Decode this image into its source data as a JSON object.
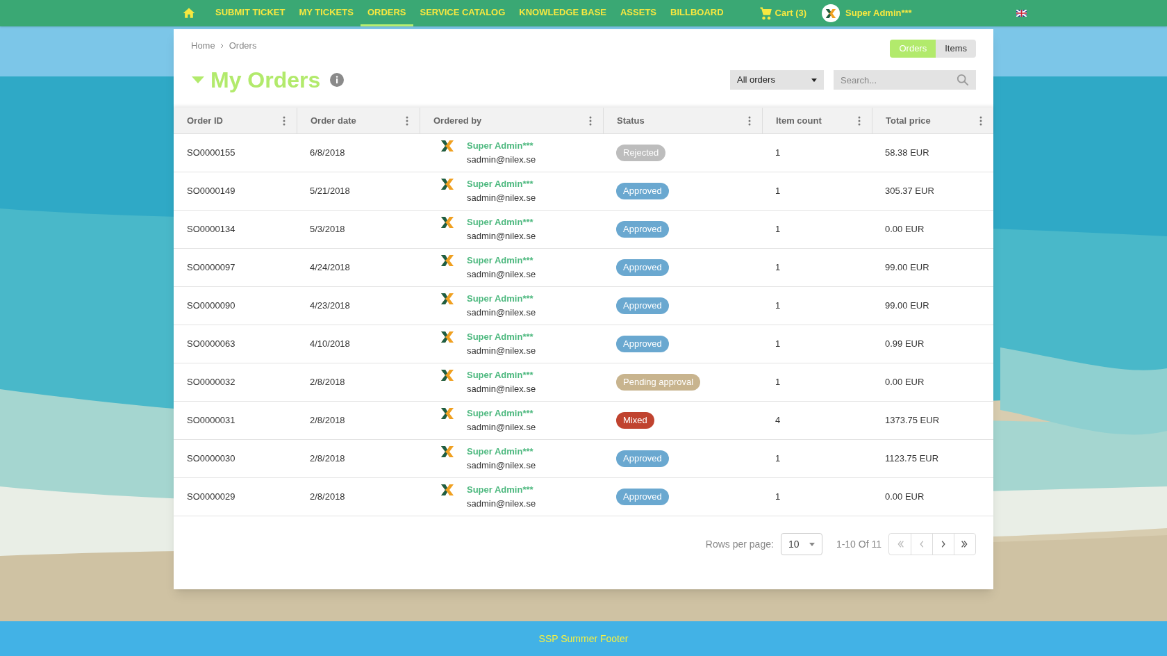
{
  "nav": {
    "items": [
      {
        "label": "SUBMIT TICKET",
        "selected": false
      },
      {
        "label": "MY TICKETS",
        "selected": false
      },
      {
        "label": "ORDERS",
        "selected": true
      },
      {
        "label": "SERVICE CATALOG",
        "selected": false
      },
      {
        "label": "KNOWLEDGE BASE",
        "selected": false
      },
      {
        "label": "ASSETS",
        "selected": false
      },
      {
        "label": "BILLBOARD",
        "selected": false
      }
    ],
    "cart": "Cart (3)",
    "user": "Super Admin***"
  },
  "breadcrumb": [
    "Home",
    "Orders"
  ],
  "view_toggle": [
    {
      "label": "Orders",
      "selected": true
    },
    {
      "label": "Items",
      "selected": false
    }
  ],
  "title": "My Orders",
  "expanded": true,
  "filter": "All orders",
  "search": {
    "placeholder": "Search..."
  },
  "table": {
    "columns": [
      "Order ID",
      "Order date",
      "Ordered by",
      "Status",
      "Item count",
      "Total price"
    ],
    "rows": [
      {
        "id": "SO0000155",
        "date": "6/8/2018",
        "name": "Super Admin***",
        "email": "sadmin@nilex.se",
        "status": {
          "label": "Rejected",
          "kind": "rejected"
        },
        "count": "1",
        "price": "58.38 EUR"
      },
      {
        "id": "SO0000149",
        "date": "5/21/2018",
        "name": "Super Admin***",
        "email": "sadmin@nilex.se",
        "status": {
          "label": "Approved",
          "kind": "approved"
        },
        "count": "1",
        "price": "305.37 EUR"
      },
      {
        "id": "SO0000134",
        "date": "5/3/2018",
        "name": "Super Admin***",
        "email": "sadmin@nilex.se",
        "status": {
          "label": "Approved",
          "kind": "approved"
        },
        "count": "1",
        "price": "0.00 EUR"
      },
      {
        "id": "SO0000097",
        "date": "4/24/2018",
        "name": "Super Admin***",
        "email": "sadmin@nilex.se",
        "status": {
          "label": "Approved",
          "kind": "approved"
        },
        "count": "1",
        "price": "99.00 EUR"
      },
      {
        "id": "SO0000090",
        "date": "4/23/2018",
        "name": "Super Admin***",
        "email": "sadmin@nilex.se",
        "status": {
          "label": "Approved",
          "kind": "approved"
        },
        "count": "1",
        "price": "99.00 EUR"
      },
      {
        "id": "SO0000063",
        "date": "4/10/2018",
        "name": "Super Admin***",
        "email": "sadmin@nilex.se",
        "status": {
          "label": "Approved",
          "kind": "approved"
        },
        "count": "1",
        "price": "0.99 EUR"
      },
      {
        "id": "SO0000032",
        "date": "2/8/2018",
        "name": "Super Admin***",
        "email": "sadmin@nilex.se",
        "status": {
          "label": "Pending approval",
          "kind": "pending"
        },
        "count": "1",
        "price": "0.00 EUR"
      },
      {
        "id": "SO0000031",
        "date": "2/8/2018",
        "name": "Super Admin***",
        "email": "sadmin@nilex.se",
        "status": {
          "label": "Mixed",
          "kind": "mixed"
        },
        "count": "4",
        "price": "1373.75 EUR"
      },
      {
        "id": "SO0000030",
        "date": "2/8/2018",
        "name": "Super Admin***",
        "email": "sadmin@nilex.se",
        "status": {
          "label": "Approved",
          "kind": "approved"
        },
        "count": "1",
        "price": "1123.75 EUR"
      },
      {
        "id": "SO0000029",
        "date": "2/8/2018",
        "name": "Super Admin***",
        "email": "sadmin@nilex.se",
        "status": {
          "label": "Approved",
          "kind": "approved"
        },
        "count": "1",
        "price": "0.00 EUR"
      }
    ]
  },
  "pagination": {
    "label": "Rows per page:",
    "rows_per_page": "10",
    "range": "1-10 Of 11"
  },
  "footer": "SSP Summer Footer"
}
